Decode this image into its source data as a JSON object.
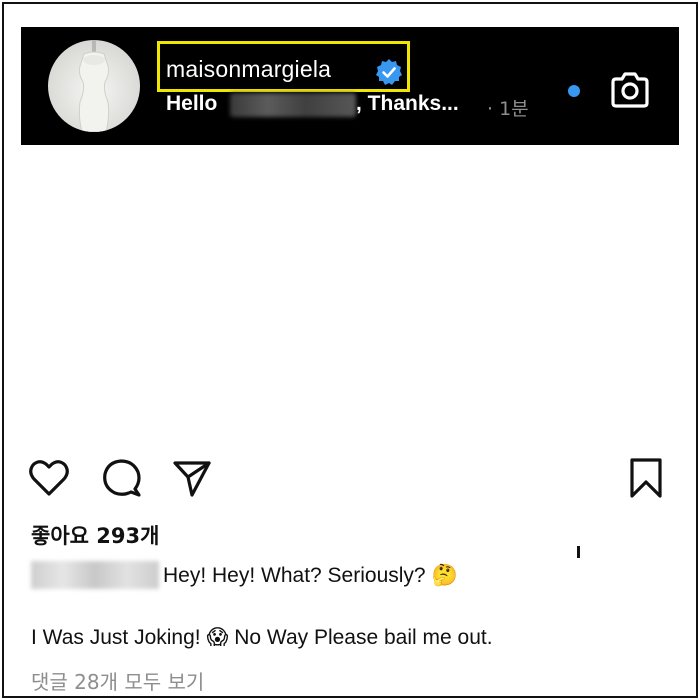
{
  "notification": {
    "username": "maisonmargiela",
    "verified": true,
    "message_prefix": "Hello",
    "message_suffix": ", Thanks...",
    "time": "· 1분",
    "unread": true,
    "icons": [
      "avatar",
      "verified-badge-icon",
      "unread-dot",
      "camera-icon"
    ],
    "colors": {
      "banner_bg": "#000000",
      "highlight_box": "#f1e600",
      "verified": "#3897f0"
    }
  },
  "post": {
    "actions": [
      "heart-icon",
      "comment-icon",
      "share-icon",
      "bookmark-icon"
    ],
    "likes_label": "좋아요 293개",
    "caption_line1": "Hey! Hey! What? Seriously?",
    "caption_line1_emoji": "🤔",
    "caption_line2_a": "I Was Just Joking!",
    "caption_line2_emoji": "😱",
    "caption_line2_b": "No Way Please bail me out.",
    "view_comments": "댓글 28개 모두 보기"
  }
}
